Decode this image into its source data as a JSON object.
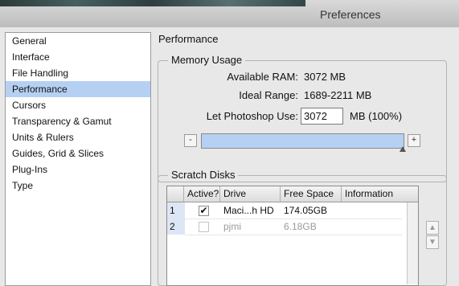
{
  "window": {
    "title": "Preferences"
  },
  "sidebar": {
    "items": [
      {
        "label": "General",
        "selected": false
      },
      {
        "label": "Interface",
        "selected": false
      },
      {
        "label": "File Handling",
        "selected": false
      },
      {
        "label": "Performance",
        "selected": true
      },
      {
        "label": "Cursors",
        "selected": false
      },
      {
        "label": "Transparency & Gamut",
        "selected": false
      },
      {
        "label": "Units & Rulers",
        "selected": false
      },
      {
        "label": "Guides, Grid & Slices",
        "selected": false
      },
      {
        "label": "Plug-Ins",
        "selected": false
      },
      {
        "label": "Type",
        "selected": false
      }
    ]
  },
  "panel": {
    "title": "Performance"
  },
  "memory": {
    "group_label": "Memory Usage",
    "available_ram_label": "Available RAM:",
    "available_ram_value": "3072 MB",
    "ideal_range_label": "Ideal Range:",
    "ideal_range_value": "1689-2211 MB",
    "let_ps_use_label": "Let Photoshop Use:",
    "let_ps_use_value": "3072",
    "unit_label": "MB (100%)",
    "minus_label": "-",
    "plus_label": "+",
    "slider_fraction": 1.0
  },
  "scratch": {
    "group_label": "Scratch Disks",
    "columns": [
      "Active?",
      "Drive",
      "Free Space",
      "Information"
    ],
    "rows": [
      {
        "num": "1",
        "active": true,
        "active_mark": "✔",
        "drive": "Maci...h HD",
        "free": "174.05GB",
        "info": "",
        "enabled": true
      },
      {
        "num": "2",
        "active": false,
        "active_mark": "",
        "drive": "pjmi",
        "free": "6.18GB",
        "info": "",
        "enabled": false
      }
    ],
    "move_up_icon": "up-arrow-icon",
    "move_down_icon": "down-arrow-icon"
  },
  "colors": {
    "selection": "#b6d0f3",
    "disabled_text": "#9a9a9a"
  }
}
